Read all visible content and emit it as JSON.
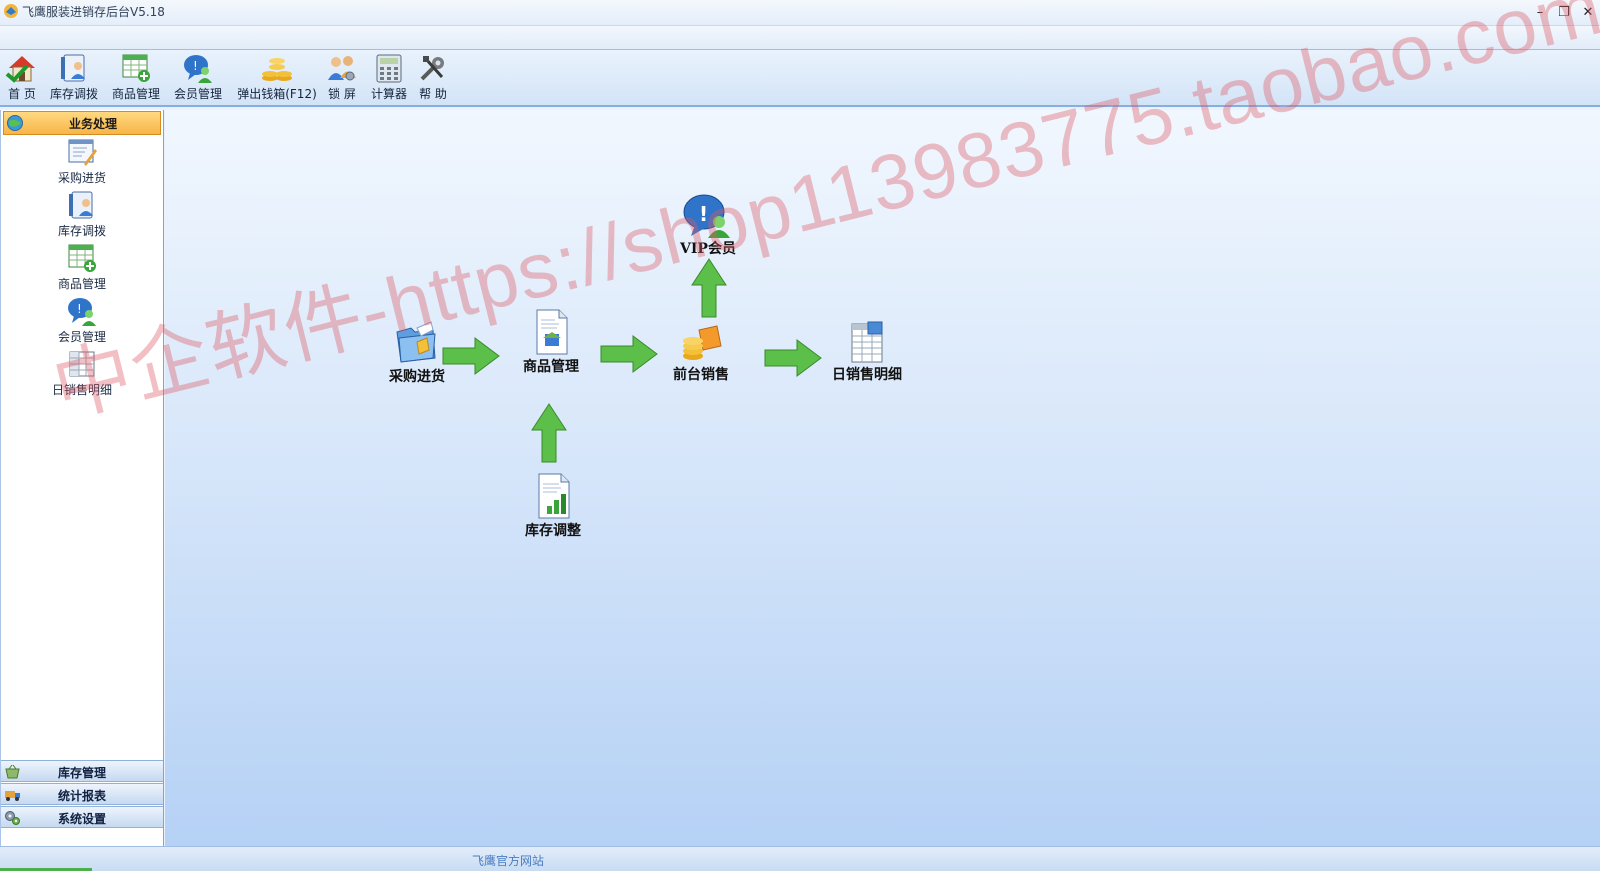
{
  "window": {
    "title": "飞鹰服装进销存后台V5.18",
    "controls": {
      "minimize": "–",
      "restore": "❐",
      "close": "✕"
    }
  },
  "toolbar": {
    "items": [
      {
        "label": "首 页",
        "icon": "home-icon"
      },
      {
        "label": "库存调拨",
        "icon": "inventory-transfer-icon"
      },
      {
        "label": "商品管理",
        "icon": "product-grid-icon"
      },
      {
        "label": "会员管理",
        "icon": "member-chat-icon"
      },
      {
        "label": "弹出钱箱(F12)",
        "icon": "cash-drawer-coins-icon"
      },
      {
        "label": "锁 屏",
        "icon": "lock-screen-users-icon"
      },
      {
        "label": "计算器",
        "icon": "calculator-icon"
      },
      {
        "label": "帮 助",
        "icon": "help-tools-icon"
      }
    ]
  },
  "sidebar": {
    "header": "业务处理",
    "items": [
      {
        "label": "采购进货",
        "icon": "purchase-edit-icon"
      },
      {
        "label": "库存调拨",
        "icon": "inventory-transfer-icon"
      },
      {
        "label": "商品管理",
        "icon": "product-grid-icon"
      },
      {
        "label": "会员管理",
        "icon": "member-chat-icon"
      },
      {
        "label": "日销售明细",
        "icon": "daily-sales-table-icon"
      }
    ],
    "bottom_tabs": [
      {
        "label": "库存管理",
        "icon": "basket-icon"
      },
      {
        "label": "统计报表",
        "icon": "truck-icon"
      },
      {
        "label": "系统设置",
        "icon": "gears-icon"
      }
    ]
  },
  "flow": {
    "nodes": {
      "purchase": "采购进货",
      "product": "商品管理",
      "sales": "前台销售",
      "vip": "VIP会员",
      "daily": "日销售明细",
      "stock_adjust": "库存调整"
    }
  },
  "watermark": "中企软件-https://shop113983775.taobao.com",
  "status": {
    "link": "飞鹰官方网站"
  },
  "colors": {
    "accent_orange": "#f7b548",
    "arrow_green": "#5cbf4a",
    "main_bg_bottom": "#b5d1f5",
    "watermark": "#dc5a64"
  }
}
